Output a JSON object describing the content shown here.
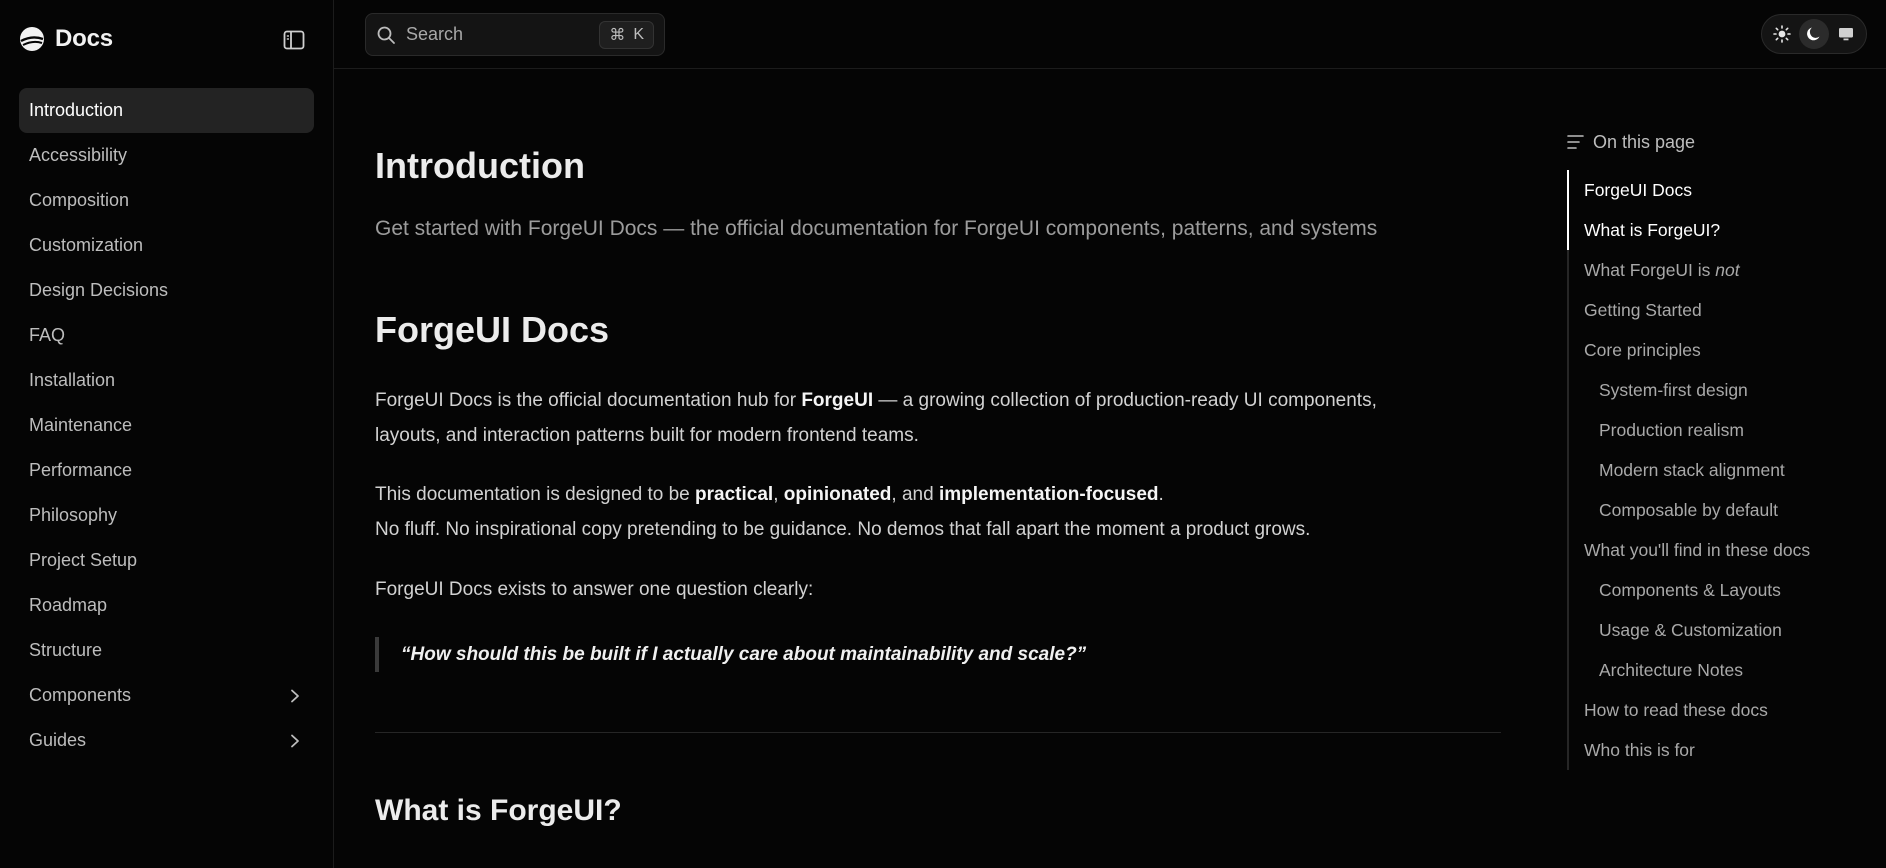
{
  "brand": {
    "title": "Docs"
  },
  "sidebar": {
    "items": [
      {
        "label": "Introduction",
        "active": true
      },
      {
        "label": "Accessibility"
      },
      {
        "label": "Composition"
      },
      {
        "label": "Customization"
      },
      {
        "label": "Design Decisions"
      },
      {
        "label": "FAQ"
      },
      {
        "label": "Installation"
      },
      {
        "label": "Maintenance"
      },
      {
        "label": "Performance"
      },
      {
        "label": "Philosophy"
      },
      {
        "label": "Project Setup"
      },
      {
        "label": "Roadmap"
      },
      {
        "label": "Structure"
      },
      {
        "label": "Components",
        "expandable": true
      },
      {
        "label": "Guides",
        "expandable": true
      }
    ]
  },
  "search": {
    "label": "Search",
    "shortcut_symbol": "⌘",
    "shortcut_key": "K"
  },
  "theme": {
    "options": [
      "sun-icon",
      "moon-icon",
      "monitor-icon"
    ],
    "selected": "moon-icon"
  },
  "page": {
    "title": "Introduction",
    "description": "Get started with ForgeUI Docs — the official documentation for ForgeUI components, patterns, and systems",
    "section1_title": "ForgeUI Docs",
    "p1": {
      "a": "ForgeUI Docs is the official documentation hub for ",
      "b": "ForgeUI",
      "c": " — a growing collection of production-ready UI components,",
      "d": "layouts, and interaction patterns built for modern frontend teams."
    },
    "p2": {
      "a": "This documentation is designed to be ",
      "b1": "practical",
      "s1": ", ",
      "b2": "opinionated",
      "s2": ", and ",
      "b3": "implementation-focused",
      "s3": ".",
      "line2": "No fluff. No inspirational copy pretending to be guidance. No demos that fall apart the moment a product grows."
    },
    "p3": "ForgeUI Docs exists to answer one question clearly:",
    "quote": "“How should this be built if I actually care about maintainability and scale?”",
    "section2_title": "What is ForgeUI?"
  },
  "toc": {
    "heading": "On this page",
    "items": [
      {
        "label": "ForgeUI Docs",
        "active": true
      },
      {
        "label": "What is ForgeUI?",
        "active": true
      },
      {
        "label": "What ForgeUI is ",
        "emphasis": "not"
      },
      {
        "label": "Getting Started"
      },
      {
        "label": "Core principles"
      },
      {
        "label": "System-first design",
        "indent": true
      },
      {
        "label": "Production realism",
        "indent": true
      },
      {
        "label": "Modern stack alignment",
        "indent": true
      },
      {
        "label": "Composable by default",
        "indent": true
      },
      {
        "label": "What you'll find in these docs"
      },
      {
        "label": "Components & Layouts",
        "indent": true
      },
      {
        "label": "Usage & Customization",
        "indent": true
      },
      {
        "label": "Architecture Notes",
        "indent": true
      },
      {
        "label": "How to read these docs"
      },
      {
        "label": "Who this is for"
      }
    ]
  }
}
